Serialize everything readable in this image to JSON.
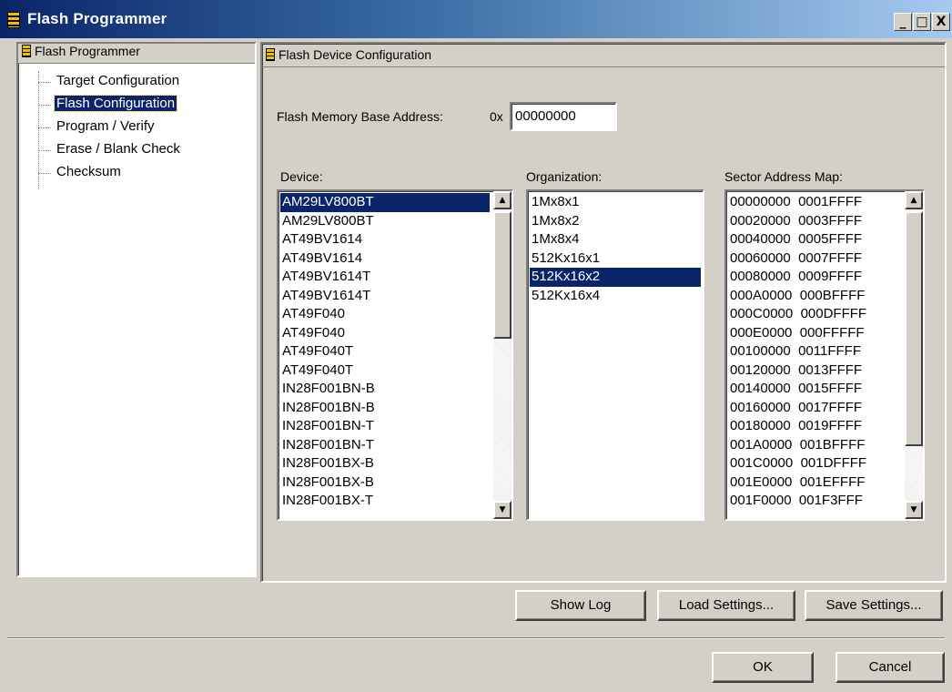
{
  "window": {
    "title": "Flash Programmer",
    "minimize": "_",
    "maximize": "□",
    "close": "X"
  },
  "tree": {
    "root_label": "Flash Programmer",
    "items": [
      {
        "label": "Target Configuration"
      },
      {
        "label": "Flash Configuration"
      },
      {
        "label": "Program / Verify"
      },
      {
        "label": "Erase / Blank Check"
      },
      {
        "label": "Checksum"
      }
    ],
    "selected": "Flash Configuration"
  },
  "panel": {
    "title": "Flash Device Configuration",
    "base_address_label": "Flash Memory Base Address:",
    "base_address_prefix": "0x",
    "base_address_value": "00000000",
    "device_label": "Device:",
    "organization_label": "Organization:",
    "sector_map_label": "Sector Address Map:"
  },
  "devices": [
    "AM29LV800BT",
    "AM29LV800BT",
    "AT49BV1614",
    "AT49BV1614",
    "AT49BV1614T",
    "AT49BV1614T",
    "AT49F040",
    "AT49F040",
    "AT49F040T",
    "AT49F040T",
    "IN28F001BN-B",
    "IN28F001BN-B",
    "IN28F001BN-T",
    "IN28F001BN-T",
    "IN28F001BX-B",
    "IN28F001BX-B",
    "IN28F001BX-T"
  ],
  "devices_selected": "AM29LV800BT",
  "organizations": [
    "1Mx8x1",
    "1Mx8x2",
    "1Mx8x4",
    "512Kx16x1",
    "512Kx16x2",
    "512Kx16x4"
  ],
  "organization_selected": "512Kx16x2",
  "sector_map": [
    "00000000  0001FFFF",
    "00020000  0003FFFF",
    "00040000  0005FFFF",
    "00060000  0007FFFF",
    "00080000  0009FFFF",
    "000A0000  000BFFFF",
    "000C0000  000DFFFF",
    "000E0000  000FFFFF",
    "00100000  0011FFFF",
    "00120000  0013FFFF",
    "00140000  0015FFFF",
    "00160000  0017FFFF",
    "00180000  0019FFFF",
    "001A0000  001BFFFF",
    "001C0000  001DFFFF",
    "001E0000  001EFFFF",
    "001F0000  001F3FFF"
  ],
  "buttons": {
    "show_log": "Show Log",
    "load_settings": "Load Settings...",
    "save_settings": "Save Settings...",
    "ok": "OK",
    "cancel": "Cancel"
  },
  "scroll_arrows": {
    "up": "▲",
    "down": "▼"
  },
  "colors": {
    "selection": "#0a246a",
    "face": "#d4d0c8"
  }
}
